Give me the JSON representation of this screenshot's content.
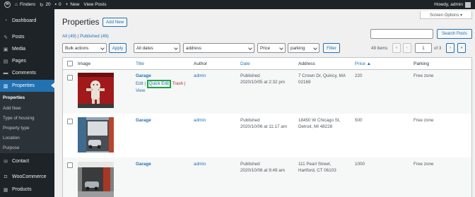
{
  "adminbar": {
    "site_name": "Findero",
    "updates_count": "20",
    "comments_count": "0",
    "new_label": "New",
    "view_posts_label": "View Posts",
    "howdy": "Howdy, admin"
  },
  "sidebar": {
    "items": [
      {
        "label": "Dashboard",
        "icon": "dashboard-icon"
      },
      {
        "label": "Posts",
        "icon": "pin-icon"
      },
      {
        "label": "Media",
        "icon": "media-icon"
      },
      {
        "label": "Pages",
        "icon": "page-icon"
      },
      {
        "label": "Comments",
        "icon": "comment-icon"
      },
      {
        "label": "Properties",
        "icon": "properties-icon"
      },
      {
        "label": "Contact",
        "icon": "mail-icon"
      },
      {
        "label": "WooCommerce",
        "icon": "woo-icon"
      },
      {
        "label": "Products",
        "icon": "products-icon"
      }
    ],
    "submenu": [
      "Properties",
      "Add New",
      "Type of housing",
      "Property type",
      "Location",
      "Purpose"
    ]
  },
  "header": {
    "title": "Properties",
    "add_new": "Add New",
    "screen_options": "Screen Options ▾",
    "filter_all": "All (49)",
    "separator": "|",
    "filter_published": "Published (49)",
    "search_button": "Search Posts",
    "search_value": ""
  },
  "tablenav": {
    "bulk_actions": "Bulk actions",
    "apply": "Apply",
    "dates": "All dates",
    "address": "address",
    "price": "Price",
    "parking": "parking",
    "filter": "Filter",
    "items_count": "49 items",
    "first": "«",
    "prev": "‹",
    "current_page": "1",
    "of_pages": "of 3",
    "next": "›",
    "last": "»"
  },
  "table": {
    "columns": [
      "Image",
      "Title",
      "Author",
      "Date",
      "Address",
      "Price ▲",
      "Parking"
    ],
    "rows": [
      {
        "title": "Garage",
        "author": "admin",
        "date_status": "Published",
        "date_value": "2020/10/05 at 2:32 pm",
        "address_line1": "7 Crown Dr, Quincy, MA",
        "address_line2": "02169",
        "price": "220",
        "parking": "Free zone",
        "actions": {
          "edit": "Edit",
          "sep1": "|",
          "quick_edit": "Quick Edit",
          "trash": "Trash",
          "sep2": "|",
          "view": "View"
        }
      },
      {
        "title": "Garage",
        "author": "admin",
        "date_status": "Published",
        "date_value": "2020/10/06 at 11:17 am",
        "address_line1": "18450 W Chicago St,",
        "address_line2": "Detroit, MI 48228",
        "price": "500",
        "parking": "Free zone"
      },
      {
        "title": "Garage",
        "author": "admin",
        "date_status": "Published",
        "date_value": "2020/10/06 at 9:49 am",
        "address_line1": "111 Pearl Street,",
        "address_line2": "Hartford, CT 06103",
        "price": "1000",
        "parking": "Free zone"
      }
    ]
  },
  "colors": {
    "accent": "#2271b1",
    "sidebar_bg": "#1d2327",
    "highlight": "#1aa644"
  }
}
